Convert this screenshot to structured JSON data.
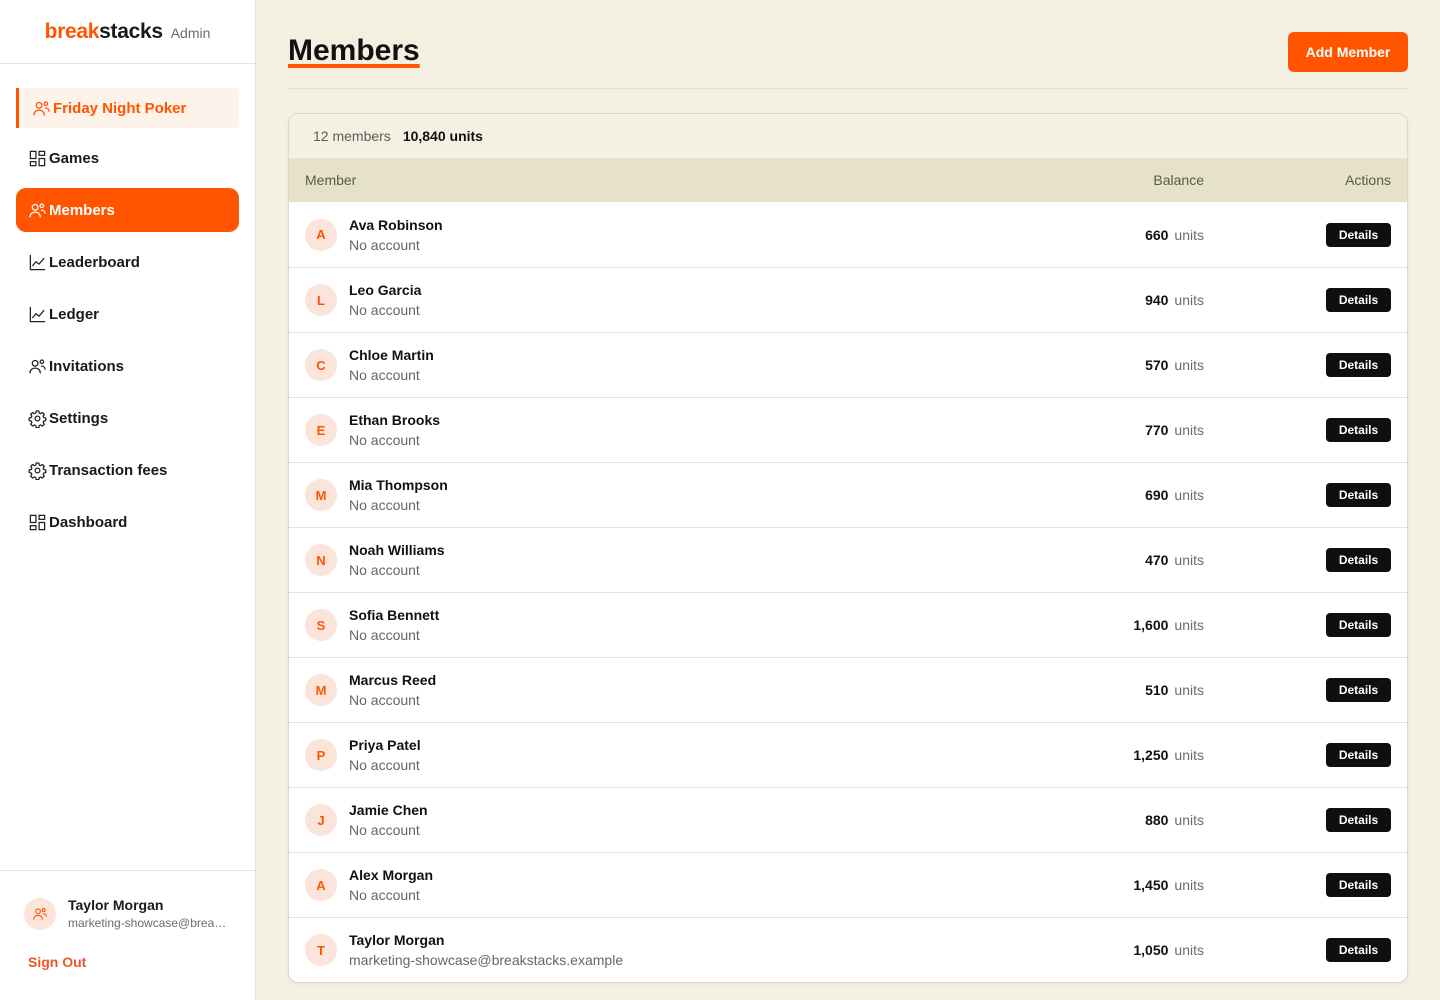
{
  "brand": {
    "part1": "break",
    "part2": "stacks",
    "admin_label": "Admin"
  },
  "sidebar": {
    "group": "Friday Night Poker",
    "items": [
      {
        "label": "Games",
        "icon": "grid-icon"
      },
      {
        "label": "Members",
        "icon": "users-icon",
        "active": true
      },
      {
        "label": "Leaderboard",
        "icon": "chart-line-icon"
      },
      {
        "label": "Ledger",
        "icon": "chart-line-icon"
      },
      {
        "label": "Invitations",
        "icon": "users-icon"
      },
      {
        "label": "Settings",
        "icon": "gear-icon"
      },
      {
        "label": "Transaction fees",
        "icon": "gear-icon"
      },
      {
        "label": "Dashboard",
        "icon": "grid-icon"
      }
    ]
  },
  "user": {
    "name": "Taylor Morgan",
    "email": "marketing-showcase@breakstacks.example",
    "sign_out": "Sign Out"
  },
  "page": {
    "title": "Members",
    "add_button": "Add Member"
  },
  "summary": {
    "members_count": "12 members",
    "total_units": "10,840 units"
  },
  "table": {
    "headers": {
      "member": "Member",
      "balance": "Balance",
      "actions": "Actions"
    },
    "unit_label": "units",
    "details_label": "Details",
    "rows": [
      {
        "initial": "A",
        "name": "Ava Robinson",
        "sub": "No account",
        "balance": "660"
      },
      {
        "initial": "L",
        "name": "Leo Garcia",
        "sub": "No account",
        "balance": "940"
      },
      {
        "initial": "C",
        "name": "Chloe Martin",
        "sub": "No account",
        "balance": "570"
      },
      {
        "initial": "E",
        "name": "Ethan Brooks",
        "sub": "No account",
        "balance": "770"
      },
      {
        "initial": "M",
        "name": "Mia Thompson",
        "sub": "No account",
        "balance": "690"
      },
      {
        "initial": "N",
        "name": "Noah Williams",
        "sub": "No account",
        "balance": "470"
      },
      {
        "initial": "S",
        "name": "Sofia Bennett",
        "sub": "No account",
        "balance": "1,600"
      },
      {
        "initial": "M",
        "name": "Marcus Reed",
        "sub": "No account",
        "balance": "510"
      },
      {
        "initial": "P",
        "name": "Priya Patel",
        "sub": "No account",
        "balance": "1,250"
      },
      {
        "initial": "J",
        "name": "Jamie Chen",
        "sub": "No account",
        "balance": "880"
      },
      {
        "initial": "A",
        "name": "Alex Morgan",
        "sub": "No account",
        "balance": "1,450"
      },
      {
        "initial": "T",
        "name": "Taylor Morgan",
        "sub": "marketing-showcase@breakstacks.example",
        "balance": "1,050"
      }
    ]
  },
  "colors": {
    "accent": "#ff5500",
    "background": "#f3efe1",
    "table_header": "#e6e2c9",
    "button_dark": "#0f0f0f"
  }
}
